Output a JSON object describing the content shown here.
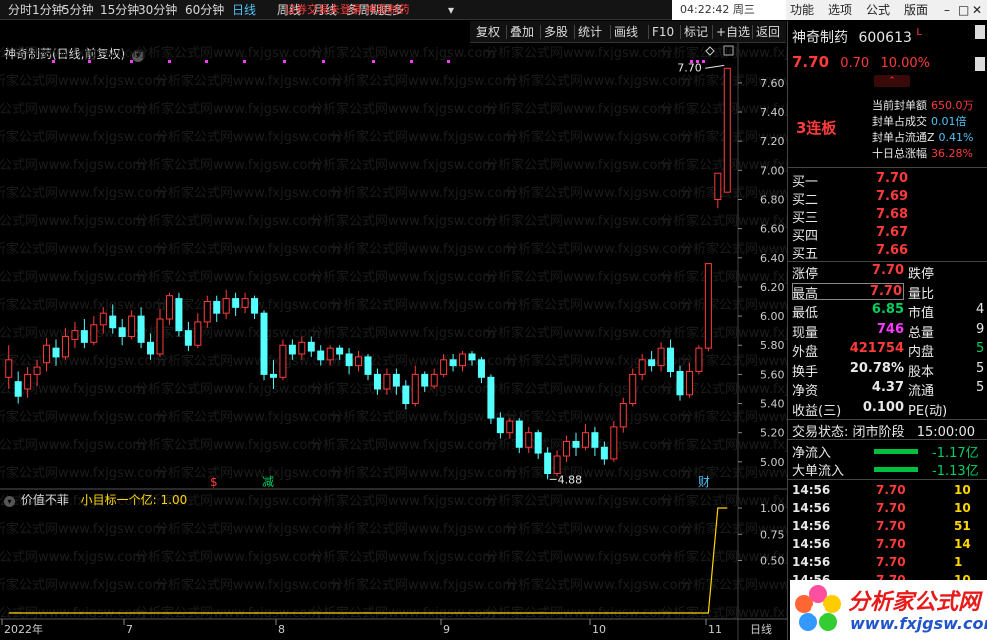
{
  "timeframes": [
    "分时",
    "1分钟",
    "5分钟",
    "15分钟",
    "30分钟",
    "60分钟",
    "日线",
    "周线",
    "月线",
    "多周期",
    "更多"
  ],
  "active_timeframe": "日线",
  "notice": "证券交易未登录   神奇制药",
  "clock": "04:22:42 周三",
  "menu": [
    "功能",
    "选项",
    "公式",
    "版面"
  ],
  "toolbar2": [
    "复权",
    "叠加",
    "多股",
    "统计",
    "画线",
    "F10",
    "标记",
    "+自选",
    "返回"
  ],
  "chart": {
    "title": "神奇制药(日线,前复权)",
    "price_labels": [
      "7.60",
      "7.40",
      "7.20",
      "7.00",
      "6.80",
      "6.60",
      "6.40",
      "6.20",
      "6.00",
      "5.80",
      "5.60",
      "5.40",
      "5.20",
      "5.00"
    ],
    "price_values": [
      7.6,
      7.4,
      7.2,
      7.0,
      6.8,
      6.6,
      6.4,
      6.2,
      6.0,
      5.8,
      5.6,
      5.4,
      5.2,
      5.0
    ],
    "high_annot": "7.70",
    "low_annot": "4.88",
    "markers": [
      {
        "text": "$",
        "color": "#ff3b3b"
      },
      {
        "text": "减",
        "color": "#00d060"
      },
      {
        "text": "财",
        "color": "#4fc3f7"
      }
    ],
    "date_labels": [
      "2022年",
      "7",
      "8",
      "9",
      "10",
      "11"
    ],
    "period_label": "日线",
    "watermark": "分析家公式网www.fxjgsw.com"
  },
  "indicator": {
    "name": "价值不菲",
    "line_label": "小目标一个亿: 1.00",
    "axis_labels": [
      "1.00",
      "0.75",
      "0.50"
    ],
    "axis_values": [
      1.0,
      0.75,
      0.5
    ]
  },
  "chart_data": {
    "type": "candlestick",
    "candles": [
      [
        5.58,
        5.7,
        5.8,
        5.5
      ],
      [
        5.55,
        5.45,
        5.62,
        5.4
      ],
      [
        5.5,
        5.6,
        5.65,
        5.44
      ],
      [
        5.6,
        5.65,
        5.7,
        5.52
      ],
      [
        5.68,
        5.8,
        5.85,
        5.62
      ],
      [
        5.78,
        5.72,
        5.84,
        5.66
      ],
      [
        5.72,
        5.86,
        5.92,
        5.7
      ],
      [
        5.84,
        5.9,
        5.96,
        5.78
      ],
      [
        5.9,
        5.82,
        5.98,
        5.78
      ],
      [
        5.82,
        5.94,
        6.0,
        5.8
      ],
      [
        5.94,
        6.02,
        6.06,
        5.88
      ],
      [
        6.0,
        5.92,
        6.08,
        5.88
      ],
      [
        5.92,
        5.86,
        5.98,
        5.8
      ],
      [
        5.86,
        6.0,
        6.04,
        5.84
      ],
      [
        6.0,
        5.82,
        6.06,
        5.78
      ],
      [
        5.82,
        5.74,
        5.88,
        5.7
      ],
      [
        5.74,
        5.98,
        6.05,
        5.72
      ],
      [
        5.98,
        6.14,
        6.16,
        5.94
      ],
      [
        6.12,
        5.9,
        6.16,
        5.86
      ],
      [
        5.9,
        5.8,
        5.96,
        5.76
      ],
      [
        5.8,
        5.96,
        6.02,
        5.78
      ],
      [
        5.96,
        6.1,
        6.14,
        5.92
      ],
      [
        6.1,
        6.02,
        6.14,
        5.96
      ],
      [
        6.02,
        6.12,
        6.18,
        5.98
      ],
      [
        6.12,
        6.06,
        6.16,
        6.0
      ],
      [
        6.06,
        6.12,
        6.16,
        6.02
      ],
      [
        6.12,
        6.02,
        6.14,
        5.98
      ],
      [
        6.02,
        5.6,
        6.04,
        5.56
      ],
      [
        5.6,
        5.58,
        5.7,
        5.5
      ],
      [
        5.58,
        5.8,
        5.84,
        5.56
      ],
      [
        5.8,
        5.74,
        5.84,
        5.7
      ],
      [
        5.74,
        5.82,
        5.86,
        5.7
      ],
      [
        5.82,
        5.76,
        5.86,
        5.72
      ],
      [
        5.76,
        5.7,
        5.8,
        5.66
      ],
      [
        5.7,
        5.78,
        5.8,
        5.66
      ],
      [
        5.78,
        5.74,
        5.8,
        5.7
      ],
      [
        5.74,
        5.66,
        5.78,
        5.6
      ],
      [
        5.66,
        5.72,
        5.76,
        5.62
      ],
      [
        5.72,
        5.6,
        5.74,
        5.56
      ],
      [
        5.6,
        5.5,
        5.64,
        5.46
      ],
      [
        5.5,
        5.6,
        5.64,
        5.46
      ],
      [
        5.6,
        5.52,
        5.64,
        5.46
      ],
      [
        5.52,
        5.4,
        5.56,
        5.36
      ],
      [
        5.4,
        5.6,
        5.66,
        5.38
      ],
      [
        5.6,
        5.52,
        5.62,
        5.48
      ],
      [
        5.52,
        5.6,
        5.64,
        5.5
      ],
      [
        5.6,
        5.7,
        5.74,
        5.58
      ],
      [
        5.7,
        5.66,
        5.74,
        5.62
      ],
      [
        5.66,
        5.74,
        5.76,
        5.62
      ],
      [
        5.74,
        5.7,
        5.76,
        5.66
      ],
      [
        5.7,
        5.58,
        5.72,
        5.54
      ],
      [
        5.58,
        5.3,
        5.6,
        5.26
      ],
      [
        5.3,
        5.2,
        5.34,
        5.16
      ],
      [
        5.2,
        5.28,
        5.3,
        5.16
      ],
      [
        5.28,
        5.1,
        5.3,
        5.06
      ],
      [
        5.1,
        5.2,
        5.24,
        5.06
      ],
      [
        5.2,
        5.06,
        5.22,
        5.02
      ],
      [
        5.06,
        4.92,
        5.1,
        4.88
      ],
      [
        4.92,
        5.04,
        5.08,
        4.9
      ],
      [
        5.04,
        5.14,
        5.18,
        5.0
      ],
      [
        5.14,
        5.1,
        5.2,
        5.04
      ],
      [
        5.1,
        5.2,
        5.26,
        5.08
      ],
      [
        5.2,
        5.1,
        5.24,
        5.04
      ],
      [
        5.1,
        5.02,
        5.14,
        4.98
      ],
      [
        5.02,
        5.24,
        5.28,
        5.0
      ],
      [
        5.24,
        5.4,
        5.44,
        5.2
      ],
      [
        5.4,
        5.6,
        5.64,
        5.38
      ],
      [
        5.6,
        5.7,
        5.74,
        5.56
      ],
      [
        5.7,
        5.66,
        5.76,
        5.62
      ],
      [
        5.66,
        5.78,
        5.82,
        5.62
      ],
      [
        5.78,
        5.62,
        5.84,
        5.58
      ],
      [
        5.62,
        5.46,
        5.66,
        5.42
      ],
      [
        5.46,
        5.62,
        5.68,
        5.44
      ],
      [
        5.62,
        5.78,
        5.8,
        5.6
      ],
      [
        5.78,
        6.36,
        6.36,
        5.76
      ],
      [
        6.8,
        6.98,
        6.98,
        6.74
      ],
      [
        6.85,
        7.7,
        7.7,
        6.85
      ]
    ],
    "indicator_values": [
      0,
      0,
      0,
      0,
      0,
      0,
      0,
      0,
      0,
      0,
      0,
      0,
      0,
      0,
      0,
      0,
      0,
      0,
      0,
      0,
      0,
      0,
      0,
      0,
      0,
      0,
      0,
      0,
      0,
      0,
      0,
      0,
      0,
      0,
      0,
      0,
      0,
      0,
      0,
      0,
      0,
      0,
      0,
      0,
      0,
      0,
      0,
      0,
      0,
      0,
      0,
      0,
      0,
      0,
      0,
      0,
      0,
      0,
      0,
      0,
      0,
      0,
      0,
      0,
      0,
      0,
      0,
      0,
      0,
      0,
      0,
      0,
      0,
      0,
      0,
      1,
      1
    ],
    "ylim": [
      4.8,
      7.75
    ]
  },
  "stock": {
    "name": "神奇制药",
    "code": "600613",
    "price": "7.70",
    "change": "0.70",
    "pct": "10.00%",
    "tag": "L"
  },
  "limit_info": {
    "streak": "3连板",
    "rows": [
      {
        "label": "当前封单额",
        "value": "650.0万"
      },
      {
        "label": "封单占成交",
        "value": "0.01倍"
      },
      {
        "label": "封单占流通Z",
        "value": "0.41%"
      },
      {
        "label": "十日总涨幅",
        "value": "36.28%"
      }
    ]
  },
  "order_book": [
    {
      "label": "买一",
      "price": "7.70"
    },
    {
      "label": "买二",
      "price": "7.69"
    },
    {
      "label": "买三",
      "price": "7.68"
    },
    {
      "label": "买四",
      "price": "7.67"
    },
    {
      "label": "买五",
      "price": "7.66"
    }
  ],
  "quote": [
    {
      "l1": "涨停",
      "v1": "7.70",
      "l2": "跌停",
      "v2": ""
    },
    {
      "l1": "最高",
      "v1": "7.70",
      "l2": "量比",
      "v2": ""
    },
    {
      "l1": "最低",
      "v1": "6.85",
      "l2": "市值",
      "v2": "4"
    },
    {
      "l1": "现量",
      "v1": "746",
      "l2": "总量",
      "v2": "9"
    },
    {
      "l1": "外盘",
      "v1": "421754",
      "l2": "内盘",
      "v2": "5"
    },
    {
      "l1": "换手",
      "v1": "20.78%",
      "l2": "股本",
      "v2": "5"
    },
    {
      "l1": "净资",
      "v1": "4.37",
      "l2": "流通",
      "v2": "5"
    },
    {
      "l1": "收益(三)",
      "v1": "0.100",
      "l2": "PE(动)",
      "v2": ""
    }
  ],
  "trade_status": {
    "label": "交易状态:",
    "value": "闭市阶段",
    "time": "15:00:00"
  },
  "flows": [
    {
      "label": "净流入",
      "value": "-1.17亿"
    },
    {
      "label": "大单流入",
      "value": "-1.13亿"
    }
  ],
  "ticks": [
    {
      "time": "14:56",
      "price": "7.70",
      "vol": "10"
    },
    {
      "time": "14:56",
      "price": "7.70",
      "vol": "10"
    },
    {
      "time": "14:56",
      "price": "7.70",
      "vol": "51"
    },
    {
      "time": "14:56",
      "price": "7.70",
      "vol": "14"
    },
    {
      "time": "14:56",
      "price": "7.70",
      "vol": "1"
    },
    {
      "time": "14:56",
      "price": "7.70",
      "vol": "10"
    }
  ],
  "logo": {
    "text": "分析家公式网",
    "url": "www.fxjgsw.com"
  }
}
